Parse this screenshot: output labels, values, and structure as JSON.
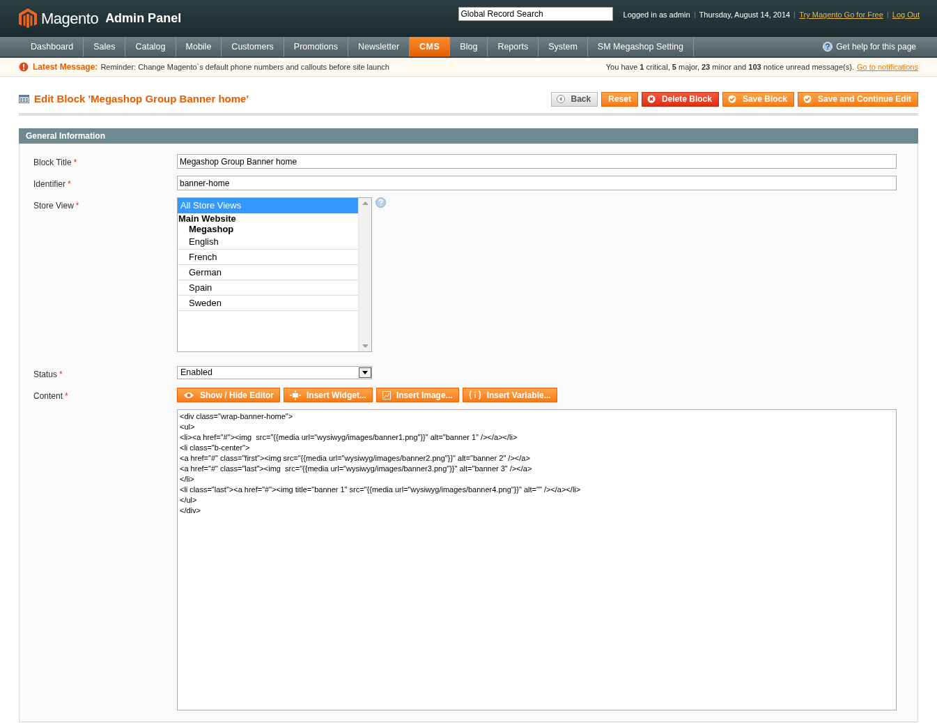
{
  "header": {
    "logo_text": "Magento",
    "logo_suffix": "Admin Panel",
    "search": {
      "value": "Global Record Search"
    },
    "user_text": "Logged in as admin",
    "date": "Thursday, August 14, 2014",
    "links": [
      "Try Magento Go for Free",
      "Log Out"
    ]
  },
  "nav": [
    {
      "label": "Dashboard",
      "selected": false
    },
    {
      "label": "Sales",
      "selected": false
    },
    {
      "label": "Catalog",
      "selected": false
    },
    {
      "label": "Mobile",
      "selected": false
    },
    {
      "label": "Customers",
      "selected": false
    },
    {
      "label": "Promotions",
      "selected": false
    },
    {
      "label": "Newsletter",
      "selected": false
    },
    {
      "label": "CMS",
      "selected": true
    },
    {
      "label": "Blog",
      "selected": false
    },
    {
      "label": "Reports",
      "selected": false
    },
    {
      "label": "System",
      "selected": false
    },
    {
      "label": "SM Megashop Setting",
      "selected": false
    }
  ],
  "help_link": "Get help for this page",
  "message": {
    "label": "Latest Message:",
    "text": "Reminder: Change Magento`s default phone numbers and callouts before site launch",
    "notice": "You have **1** critical, **5** major, **23** minor and **103** notice unread message(s).",
    "link": "Go to notifications"
  },
  "page_title": "Edit Block 'Megashop Group Banner home'",
  "actions": [
    {
      "label": "Back",
      "kind": "back"
    },
    {
      "label": "Reset",
      "kind": "plain"
    },
    {
      "label": "Delete Block",
      "kind": "delete"
    },
    {
      "label": "Save Block",
      "kind": "save"
    },
    {
      "label": "Save and Continue Edit",
      "kind": "save"
    }
  ],
  "section_title": "General Information",
  "fields": [
    {
      "label": "Block Title",
      "required_mark": "*",
      "kind": "text",
      "value": "Megashop Group Banner home"
    },
    {
      "label": "Identifier",
      "required_mark": "*",
      "kind": "text",
      "value": "banner-home"
    },
    {
      "label": "Store View",
      "required_mark": "*",
      "kind": "multiselect",
      "options": [
        {
          "label": "All Store Views",
          "selected": true
        },
        {
          "label": "Main Website",
          "children": [
            {
              "label": "Megashop",
              "children": [
                {
                  "label": "English",
                  "selected": false
                },
                {
                  "label": "French",
                  "selected": false
                },
                {
                  "label": "German",
                  "selected": false
                },
                {
                  "label": "Spain",
                  "selected": false
                },
                {
                  "label": "Sweden",
                  "selected": false
                }
              ]
            }
          ]
        }
      ]
    },
    {
      "label": "Status",
      "required_mark": "*",
      "kind": "select",
      "value": "Enabled"
    },
    {
      "label": "Content",
      "required_mark": "*",
      "kind": "editor",
      "buttons": [
        {
          "label": "Show / Hide Editor",
          "kind": "eye"
        },
        {
          "label": "Insert Widget...",
          "kind": "widget"
        },
        {
          "label": "Insert Image...",
          "kind": "image"
        },
        {
          "label": "Insert Variable...",
          "kind": "variable"
        }
      ],
      "lines": [
        "<div class=\"wrap-banner-home\">",
        "<ul>",
        "<li><a href=\"#\"><img  src=\"{{media url=\"wysiwyg/images/banner1.png\"}}\" alt=\"banner 1\" /></a></li>",
        "<li class=\"b-center\">",
        "<a href=\"#\" class=\"first\"><img src=\"{{media url=\"wysiwyg/images/banner2.png\"}}\" alt=\"banner 2\" /></a>",
        "<a href=\"#\" class=\"last\"><img  src=\"{{media url=\"wysiwyg/images/banner3.png\"}}\" alt=\"banner 3\" /></a>",
        "</li>",
        "<li class=\"last\"><a href=\"#\"><img title=\"banner 1\" src=\"{{media url=\"wysiwyg/images/banner4.png\"}}\" alt=\"\" /></a></li>",
        "</ul>",
        "</div>"
      ]
    }
  ]
}
